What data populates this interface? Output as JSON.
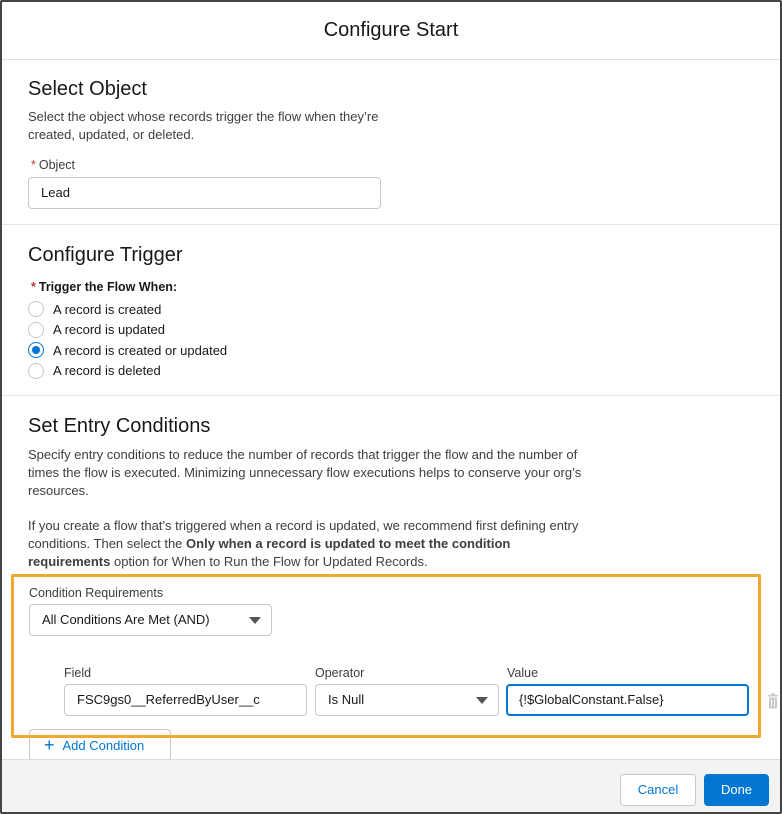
{
  "modal": {
    "title": "Configure Start"
  },
  "select_object": {
    "heading": "Select Object",
    "description_line1": "Select the object whose records trigger the flow when they’re",
    "description_line2": "created, updated, or deleted.",
    "object_label": "Object",
    "object_value": "Lead"
  },
  "configure_trigger": {
    "heading": "Configure Trigger",
    "trigger_label": "Trigger the Flow When:",
    "options": [
      {
        "label": "A record is created",
        "checked": false
      },
      {
        "label": "A record is updated",
        "checked": false
      },
      {
        "label": "A record is created or updated",
        "checked": true
      },
      {
        "label": "A record is deleted",
        "checked": false
      }
    ]
  },
  "entry_conditions": {
    "heading": "Set Entry Conditions",
    "para1_line1": "Specify entry conditions to reduce the number of records that trigger the flow and the number of",
    "para1_line2": "times the flow is executed. Minimizing unnecessary flow executions helps to conserve your org’s",
    "para1_line3": "resources.",
    "para2_line1": "If you create a flow that’s triggered when a record is updated, we recommend first defining entry",
    "para2_line2_a": "conditions. Then select the ",
    "para2_line2_bold": "Only when a record is updated to meet the condition",
    "para2_line3_bold": "requirements",
    "para2_line3_b": " option for When to Run the Flow for Updated Records.",
    "condition_requirements_label": "Condition Requirements",
    "condition_requirements_value": "All Conditions Are Met (AND)",
    "field_label": "Field",
    "field_value": "FSC9gs0__ReferredByUser__c",
    "operator_label": "Operator",
    "operator_value": "Is Null",
    "value_label": "Value",
    "value_value": "{!$GlobalConstant.False}",
    "add_condition_label": "Add Condition"
  },
  "footer": {
    "cancel_label": "Cancel",
    "done_label": "Done"
  },
  "colors": {
    "brand": "#0176d3",
    "highlight": "#f0a92c",
    "required": "#c23934"
  },
  "icons": {
    "radio": "radio-icon",
    "caret": "chevron-down-icon",
    "trash": "trash-icon",
    "plus": "plus-icon"
  }
}
